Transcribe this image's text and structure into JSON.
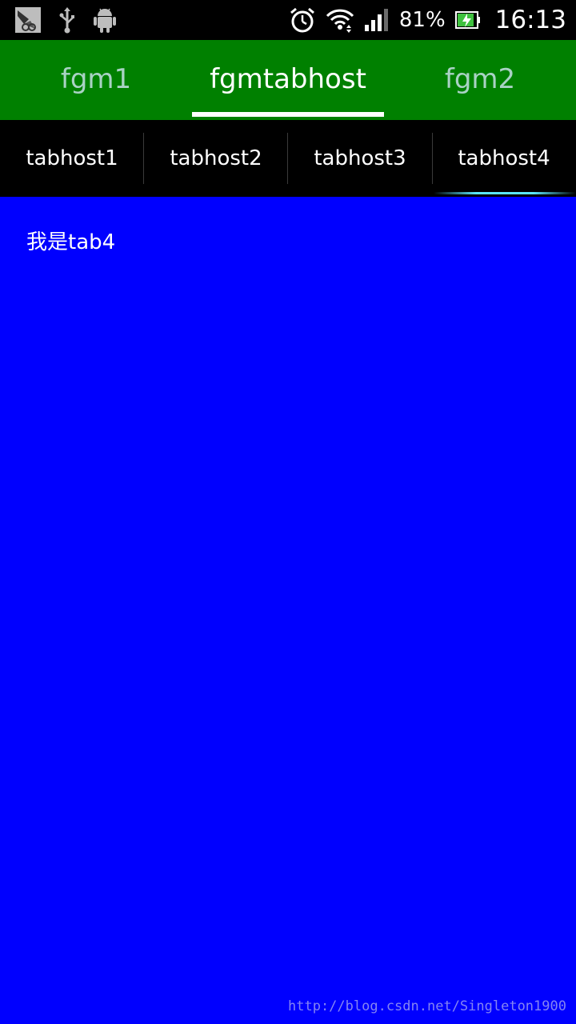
{
  "status_bar": {
    "icons_left": [
      "screenshot-icon",
      "usb-icon",
      "android-debug-icon"
    ],
    "icons_right": [
      "alarm-icon",
      "wifi-icon",
      "signal-icon",
      "battery-charging-icon"
    ],
    "battery_percent": "81%",
    "time": "16:13"
  },
  "top_tabs": {
    "items": [
      {
        "label": "fgm1"
      },
      {
        "label": "fgmtabhost"
      },
      {
        "label": "fgm2"
      }
    ],
    "selected_index": 1,
    "background_color": "#008000",
    "active_text_color": "#ffffff",
    "inactive_text_color": "#a9d2c4"
  },
  "tabhost": {
    "items": [
      {
        "label": "tabhost1"
      },
      {
        "label": "tabhost2"
      },
      {
        "label": "tabhost3"
      },
      {
        "label": "tabhost4"
      }
    ],
    "selected_index": 3,
    "indicator_color": "#5ae6ff"
  },
  "content": {
    "text": "我是tab4",
    "background_color": "#0000ff"
  },
  "watermark": {
    "text": "http://blog.csdn.net/Singleton1900"
  }
}
